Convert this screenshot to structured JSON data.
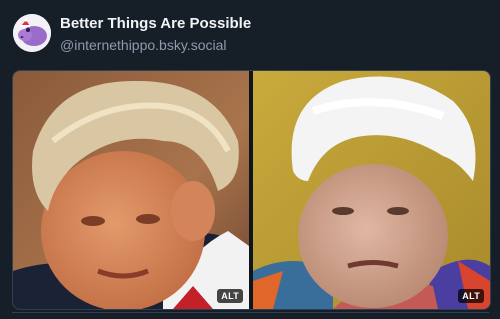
{
  "post": {
    "author": {
      "display_name": "Better Things Are Possible",
      "handle": "@internethippo.bsky.social",
      "avatar_icon": "purple-hippo-icon"
    },
    "images": [
      {
        "alt_badge": "ALT",
        "subject": "man-with-blond-hair-photo"
      },
      {
        "alt_badge": "ALT",
        "subject": "puppet-with-white-hair-photo"
      }
    ]
  },
  "colors": {
    "background": "#161e27",
    "text_primary": "#f1f3f5",
    "text_secondary": "#8c9bad",
    "border": "#2e4052"
  }
}
